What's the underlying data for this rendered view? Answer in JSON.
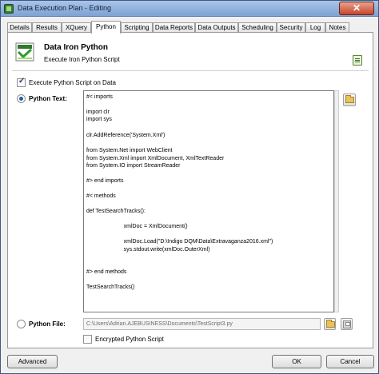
{
  "window": {
    "title": "Data Execution Plan - Editing",
    "close_glyph": "✕"
  },
  "tabs": [
    {
      "label": "Details"
    },
    {
      "label": "Results"
    },
    {
      "label": "XQuery"
    },
    {
      "label": "Python"
    },
    {
      "label": "Scripting"
    },
    {
      "label": "Data Reports"
    },
    {
      "label": "Data Outputs"
    },
    {
      "label": "Scheduling"
    },
    {
      "label": "Security"
    },
    {
      "label": "Log"
    },
    {
      "label": "Notes"
    }
  ],
  "active_tab": "Python",
  "header": {
    "title": "Data Iron Python",
    "subtitle": "Execute Iron Python Script"
  },
  "execute_checkbox": {
    "label": "Execute Python Script on Data",
    "checked": true
  },
  "python_text_radio": {
    "label": "Python Text:",
    "selected": true
  },
  "code_lines": [
    "#< imports",
    "",
    "import clr",
    "import sys",
    "",
    "clr.AddReference('System.Xml')",
    "",
    "from System.Net import WebClient",
    "from System.Xml import XmlDocument, XmlTextReader",
    "from System.IO import StreamReader",
    "",
    "#> end imports",
    "",
    "#< methods",
    "",
    "def TestSearchTracks():",
    "",
    "                        xmlDoc = XmlDocument()",
    "",
    "                        xmlDoc.Load(\"D:\\Indigo DQM\\Data\\Extravaganza2016.xml\")",
    "                        sys.stdout.write(xmlDoc.OuterXml)",
    "",
    "",
    "#> end methods",
    "",
    "TestSearchTracks()"
  ],
  "python_file_radio": {
    "label": "Python File:",
    "selected": false
  },
  "python_file_path": "C:\\Users\\Adrian.AJEBUSINESS\\Documents\\TestScript3.py",
  "encrypted_checkbox": {
    "label": "Encrypted Python Script",
    "checked": false
  },
  "footer": {
    "advanced_label": "Advanced",
    "ok_label": "OK",
    "cancel_label": "Cancel"
  },
  "icons": {
    "app": "app-icon",
    "header": "python-icon",
    "help": "help-icon",
    "open_text": "open-folder-icon",
    "open_file": "open-folder-icon",
    "save_file": "save-icon"
  }
}
